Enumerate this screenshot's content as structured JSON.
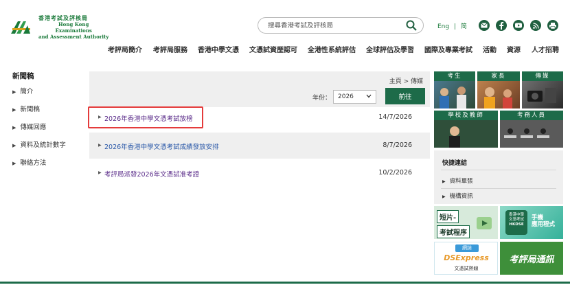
{
  "header": {
    "logo_cn": "香港考試及評核局",
    "logo_en_1": "Hong Kong",
    "logo_en_2": "Examinations",
    "logo_en_3": "and Assessment Authority",
    "search_placeholder": "搜尋香港考試及評核局",
    "lang_eng": "Eng",
    "lang_sep": "|",
    "lang_simplified": "简"
  },
  "nav": [
    "考評局簡介",
    "考評局服務",
    "香港中學文憑",
    "文憑試資歷認可",
    "全港性系統評估",
    "全球評估及學習",
    "國際及專業考試",
    "活動",
    "資源",
    "人才招聘"
  ],
  "sidebar": {
    "title": "新聞稿",
    "items": [
      "簡介",
      "新聞稿",
      "傳媒回應",
      "資料及統計數字",
      "聯絡方法"
    ]
  },
  "main": {
    "breadcrumb": "主頁 > 傳媒",
    "year_label": "年份：",
    "year_value": "2026",
    "go_label": "前往",
    "rows": [
      {
        "title": "2026年香港中學文憑考試放榜",
        "date": "14/7/2026"
      },
      {
        "title": "2026年香港中學文憑考試成績發放安排",
        "date": "8/7/2026"
      },
      {
        "title": "考評局派發2026年文憑試准考證",
        "date": "10/2/2026"
      }
    ]
  },
  "right": {
    "tiles": [
      "考生",
      "家長",
      "傳媒",
      "學校及教師",
      "考務人員"
    ],
    "quick_title": "快捷連結",
    "quick_links": [
      "資料單張",
      "機構資訊"
    ],
    "promo_short": "短片-",
    "promo_short_2": "考試程序",
    "promo_app_1": "香港中學",
    "promo_app_2": "文憑考試",
    "promo_app_3": "HKDSE",
    "promo_app_4": "手機",
    "promo_app_5": "應用程式",
    "promo_dse_top": "網誌",
    "promo_dse": "DSExpress",
    "promo_dse_sub": "文憑試熱線",
    "promo_news": "考評局通訊"
  },
  "colors": {
    "brand": "#1d6b49",
    "highlight": "#e43b3b",
    "link_purple": "#5b2d8a",
    "link_blue": "#2a58a8"
  }
}
